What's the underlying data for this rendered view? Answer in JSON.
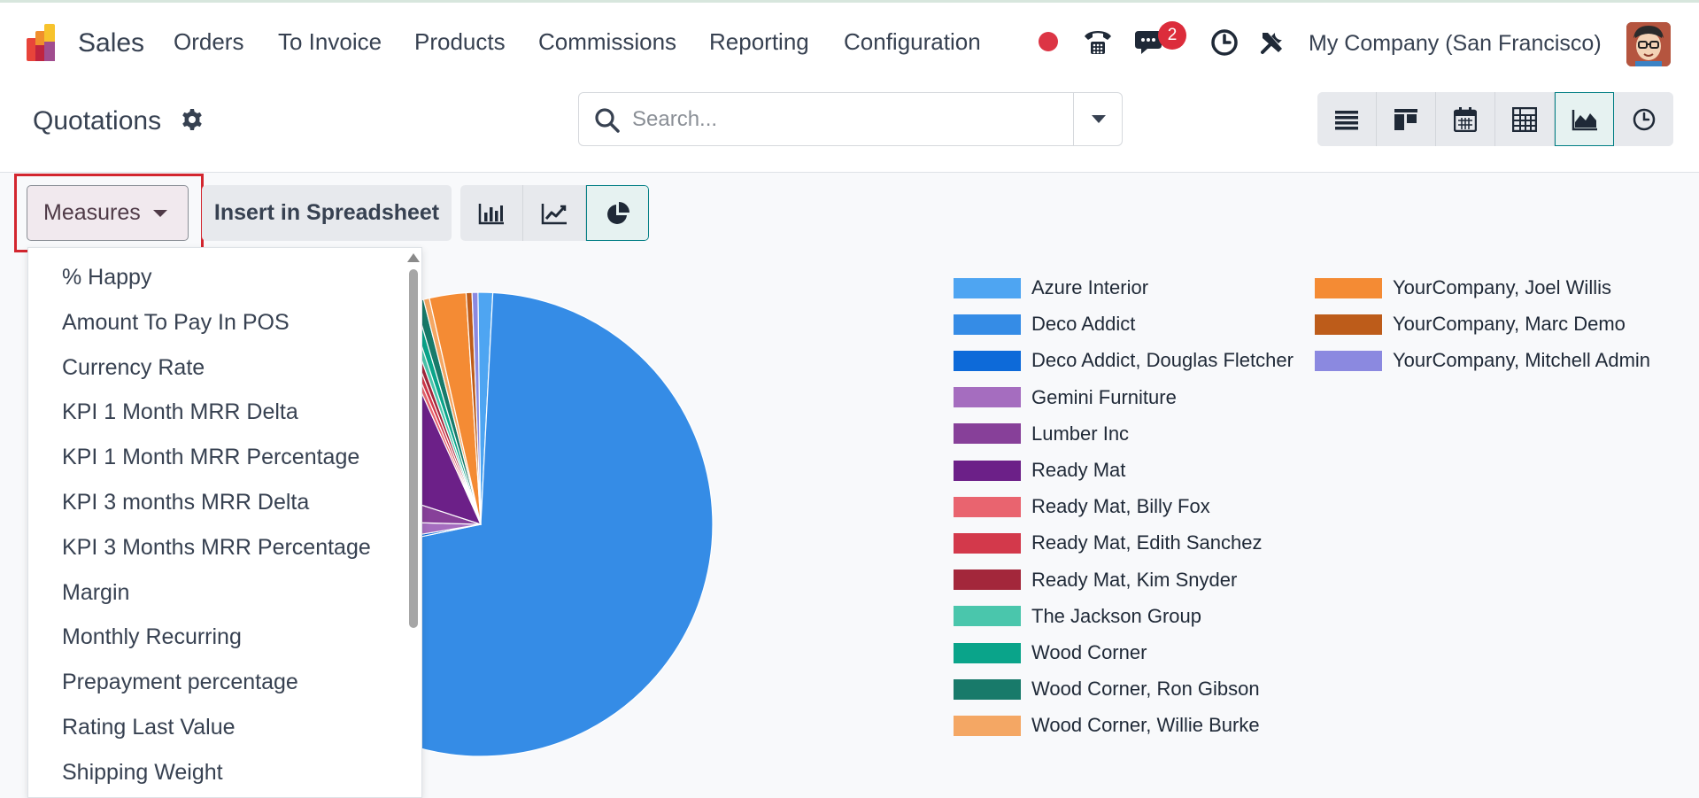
{
  "navbar": {
    "app_name": "Sales",
    "menu": [
      "Orders",
      "To Invoice",
      "Products",
      "Commissions",
      "Reporting",
      "Configuration"
    ],
    "messages_badge": "2",
    "company": "My Company (San Francisco)",
    "icons": [
      "status-dot-icon",
      "phone-icon",
      "chat-icon",
      "clock-icon",
      "tools-icon"
    ]
  },
  "control_panel": {
    "title": "Quotations",
    "search_placeholder": "Search...",
    "views": [
      "list",
      "kanban",
      "calendar",
      "pivot",
      "graph",
      "activity"
    ],
    "active_view": "graph"
  },
  "graph_toolbar": {
    "measures_label": "Measures",
    "spreadsheet_label": "Insert in Spreadsheet",
    "chart_types": [
      "bar",
      "line",
      "pie"
    ],
    "active_chart_type": "pie"
  },
  "measures_dropdown": {
    "items": [
      "% Happy",
      "Amount To Pay In POS",
      "Currency Rate",
      "KPI 1 Month MRR Delta",
      "KPI 1 Month MRR Percentage",
      "KPI 3 months MRR Delta",
      "KPI 3 Months MRR Percentage",
      "Margin",
      "Monthly Recurring",
      "Prepayment percentage",
      "Rating Last Value",
      "Shipping Weight"
    ]
  },
  "chart_data": {
    "type": "pie",
    "legend_position": "right",
    "series": [
      {
        "name": "Azure Interior",
        "color": "#4ea5f2"
      },
      {
        "name": "Deco Addict",
        "color": "#358ce6"
      },
      {
        "name": "Deco Addict, Douglas Fletcher",
        "color": "#0d6ad9"
      },
      {
        "name": "Gemini Furniture",
        "color": "#a56dbf"
      },
      {
        "name": "Lumber Inc",
        "color": "#874099"
      },
      {
        "name": "Ready Mat",
        "color": "#6c2088"
      },
      {
        "name": "Ready Mat, Billy Fox",
        "color": "#e9646f"
      },
      {
        "name": "Ready Mat, Edith Sanchez",
        "color": "#d3394b"
      },
      {
        "name": "Ready Mat, Kim Snyder",
        "color": "#a3273b"
      },
      {
        "name": "The Jackson Group",
        "color": "#4ac6ac"
      },
      {
        "name": "Wood Corner",
        "color": "#0aa48a"
      },
      {
        "name": "Wood Corner, Ron Gibson",
        "color": "#187a6a"
      },
      {
        "name": "Wood Corner, Willie Burke",
        "color": "#f4a764"
      },
      {
        "name": "YourCompany, Joel Willis",
        "color": "#f48b34"
      },
      {
        "name": "YourCompany, Marc Demo",
        "color": "#bd5c1a"
      },
      {
        "name": "YourCompany, Mitchell Admin",
        "color": "#8b89e0"
      }
    ],
    "slices": [
      {
        "name": "Azure Interior",
        "value": 1.0
      },
      {
        "name": "Deco Addict",
        "value": 69.5
      },
      {
        "name": "Deco Addict, Douglas Fletcher",
        "value": 0.6
      },
      {
        "name": "Gemini Furniture",
        "value": 3.0
      },
      {
        "name": "Lumber Inc",
        "value": 4.5
      },
      {
        "name": "Ready Mat",
        "value": 13.0
      },
      {
        "name": "Ready Mat, Billy Fox",
        "value": 0.4
      },
      {
        "name": "Ready Mat, Edith Sanchez",
        "value": 0.4
      },
      {
        "name": "Ready Mat, Kim Snyder",
        "value": 0.4
      },
      {
        "name": "The Jackson Group",
        "value": 0.4
      },
      {
        "name": "Wood Corner",
        "value": 0.5
      },
      {
        "name": "Wood Corner, Ron Gibson",
        "value": 0.6
      },
      {
        "name": "Wood Corner, Willie Burke",
        "value": 0.4
      },
      {
        "name": "YourCompany, Joel Willis",
        "value": 2.5
      },
      {
        "name": "YourCompany, Marc Demo",
        "value": 0.4
      },
      {
        "name": "YourCompany, Mitchell Admin",
        "value": 0.4
      }
    ]
  }
}
